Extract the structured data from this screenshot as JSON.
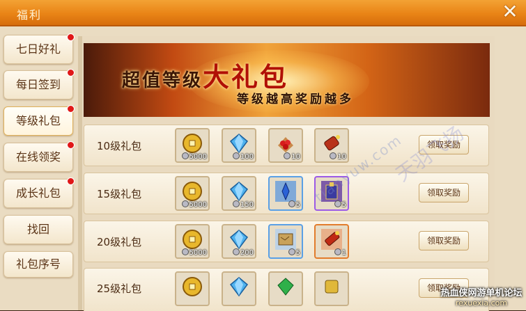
{
  "window": {
    "title": "福利",
    "close_glyph": "✕"
  },
  "sidebar": {
    "tabs": [
      {
        "label": "七日好礼",
        "badge": true
      },
      {
        "label": "每日签到",
        "badge": true
      },
      {
        "label": "等级礼包",
        "badge": true,
        "active": true
      },
      {
        "label": "在线领奖",
        "badge": true
      },
      {
        "label": "成长礼包",
        "badge": true
      },
      {
        "label": "找回",
        "badge": false
      },
      {
        "label": "礼包序号",
        "badge": false
      }
    ]
  },
  "banner": {
    "title_part1": "超值等级",
    "title_big": "大礼包",
    "subtitle": "等级越高奖励越多"
  },
  "rows": [
    {
      "label": "10级礼包",
      "claim_label": "领取奖励",
      "items": [
        {
          "icon": "gold-coin-icon",
          "qty": "5000",
          "rarity": "plain"
        },
        {
          "icon": "diamond-icon",
          "qty": "100",
          "rarity": "plain"
        },
        {
          "icon": "berries-icon",
          "qty": "10",
          "rarity": "plain"
        },
        {
          "icon": "scroll-bomb-icon",
          "qty": "10",
          "rarity": "plain"
        }
      ]
    },
    {
      "label": "15级礼包",
      "claim_label": "领取奖励",
      "items": [
        {
          "icon": "gold-coin-icon",
          "qty": "5000",
          "rarity": "plain"
        },
        {
          "icon": "diamond-icon",
          "qty": "150",
          "rarity": "plain"
        },
        {
          "icon": "blue-crystal-icon",
          "qty": "5",
          "rarity": "blue"
        },
        {
          "icon": "skill-book-icon",
          "qty": "5",
          "rarity": "purple"
        }
      ]
    },
    {
      "label": "20级礼包",
      "claim_label": "领取奖励",
      "items": [
        {
          "icon": "gold-coin-icon",
          "qty": "5000",
          "rarity": "plain"
        },
        {
          "icon": "diamond-icon",
          "qty": "200",
          "rarity": "plain"
        },
        {
          "icon": "treasure-map-icon",
          "qty": "5",
          "rarity": "blue"
        },
        {
          "icon": "firecracker-icon",
          "qty": "1",
          "rarity": "orange"
        }
      ]
    },
    {
      "label": "25级礼包",
      "claim_label": "领取奖励",
      "items": [
        {
          "icon": "gold-coin-icon",
          "qty": "",
          "rarity": "plain"
        },
        {
          "icon": "diamond-icon",
          "qty": "",
          "rarity": "plain"
        },
        {
          "icon": "green-gem-icon",
          "qty": "",
          "rarity": "plain"
        },
        {
          "icon": "gold-token-icon",
          "qty": "",
          "rarity": "plain"
        }
      ]
    }
  ],
  "watermarks": {
    "line1": "tianyuw.com",
    "line2": "天羽飞扬"
  },
  "footer_logo": {
    "line1": "热血侠网游单机论坛",
    "line2": "rexuexia.com"
  },
  "colors": {
    "title_bar": "#e98416",
    "badge": "#e01818",
    "text_brown": "#5b3416"
  }
}
